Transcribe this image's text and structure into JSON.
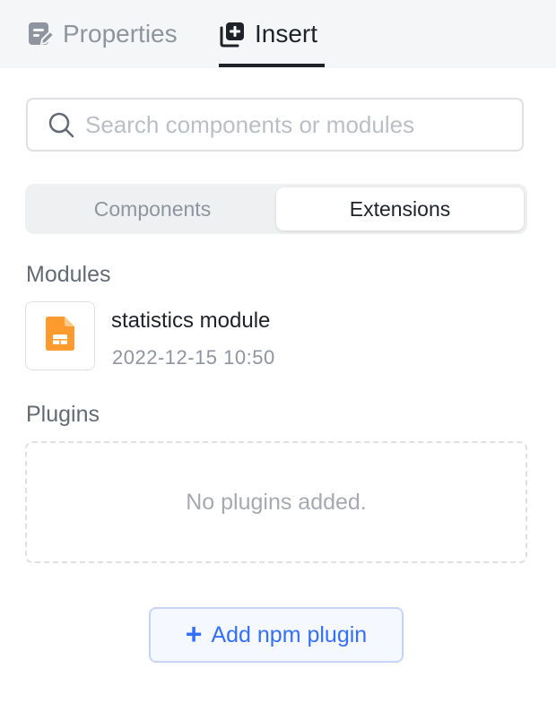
{
  "tabs": {
    "properties": {
      "label": "Properties",
      "icon": "edit-doc-icon",
      "active": false
    },
    "insert": {
      "label": "Insert",
      "icon": "add-layer-icon",
      "active": true
    }
  },
  "search": {
    "placeholder": "Search components or modules",
    "value": "",
    "icon": "search-icon"
  },
  "segment": {
    "components_label": "Components",
    "extensions_label": "Extensions",
    "selected": "Extensions"
  },
  "modules": {
    "title": "Modules",
    "items": [
      {
        "name": "statistics module",
        "date": "2022-12-15 10:50",
        "icon": "module-file-icon",
        "icon_color": "#ff9a2e"
      }
    ]
  },
  "plugins": {
    "title": "Plugins",
    "empty_text": "No plugins added."
  },
  "add_plugin": {
    "label": "Add npm plugin",
    "icon": "plus-icon"
  },
  "colors": {
    "accent": "#3370ff",
    "muted_text": "#8f959e",
    "tabbar_bg": "#f5f6f7"
  }
}
